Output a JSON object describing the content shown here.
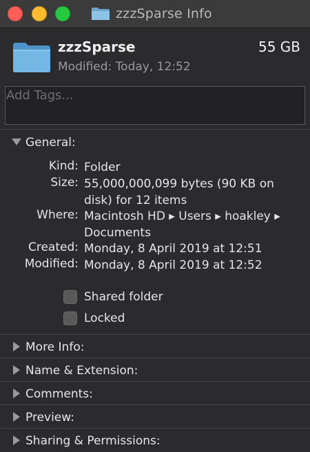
{
  "window": {
    "title": "zzzSparse Info"
  },
  "header": {
    "name": "zzzSparse",
    "size": "55 GB",
    "modified": "Modified: Today, 12:52"
  },
  "tags": {
    "placeholder": "Add Tags..."
  },
  "general": {
    "label": "General:",
    "rows": [
      {
        "label": "Kind:",
        "value": "Folder"
      },
      {
        "label": "Size:",
        "value_line1": "55,000,000,099 bytes (90 KB on",
        "value_line2": "disk) for 12 items"
      },
      {
        "label": "Where:",
        "value_line1": "Macintosh HD ▸ Users ▸ hoakley ▸",
        "value_line2": "Documents"
      },
      {
        "label": "Created:",
        "value": "Monday, 8 April 2019 at 12:51"
      },
      {
        "label": "Modified:",
        "value": "Monday, 8 April 2019 at 12:52"
      }
    ],
    "checkboxes": [
      {
        "label": "Shared folder",
        "checked": false
      },
      {
        "label": "Locked",
        "checked": false
      }
    ]
  },
  "sections": [
    {
      "label": "More Info:"
    },
    {
      "label": "Name & Extension:"
    },
    {
      "label": "Comments:"
    },
    {
      "label": "Preview:"
    },
    {
      "label": "Sharing & Permissions:"
    }
  ],
  "icons": {
    "folder": "folder-icon",
    "triangle_open": "disclosure-triangle-down-icon",
    "triangle_closed": "disclosure-triangle-right-icon"
  },
  "colors": {
    "folder_blue": "#6cb5e6",
    "close": "#fd5f57",
    "minimize": "#febc2e",
    "zoom": "#28c840"
  }
}
